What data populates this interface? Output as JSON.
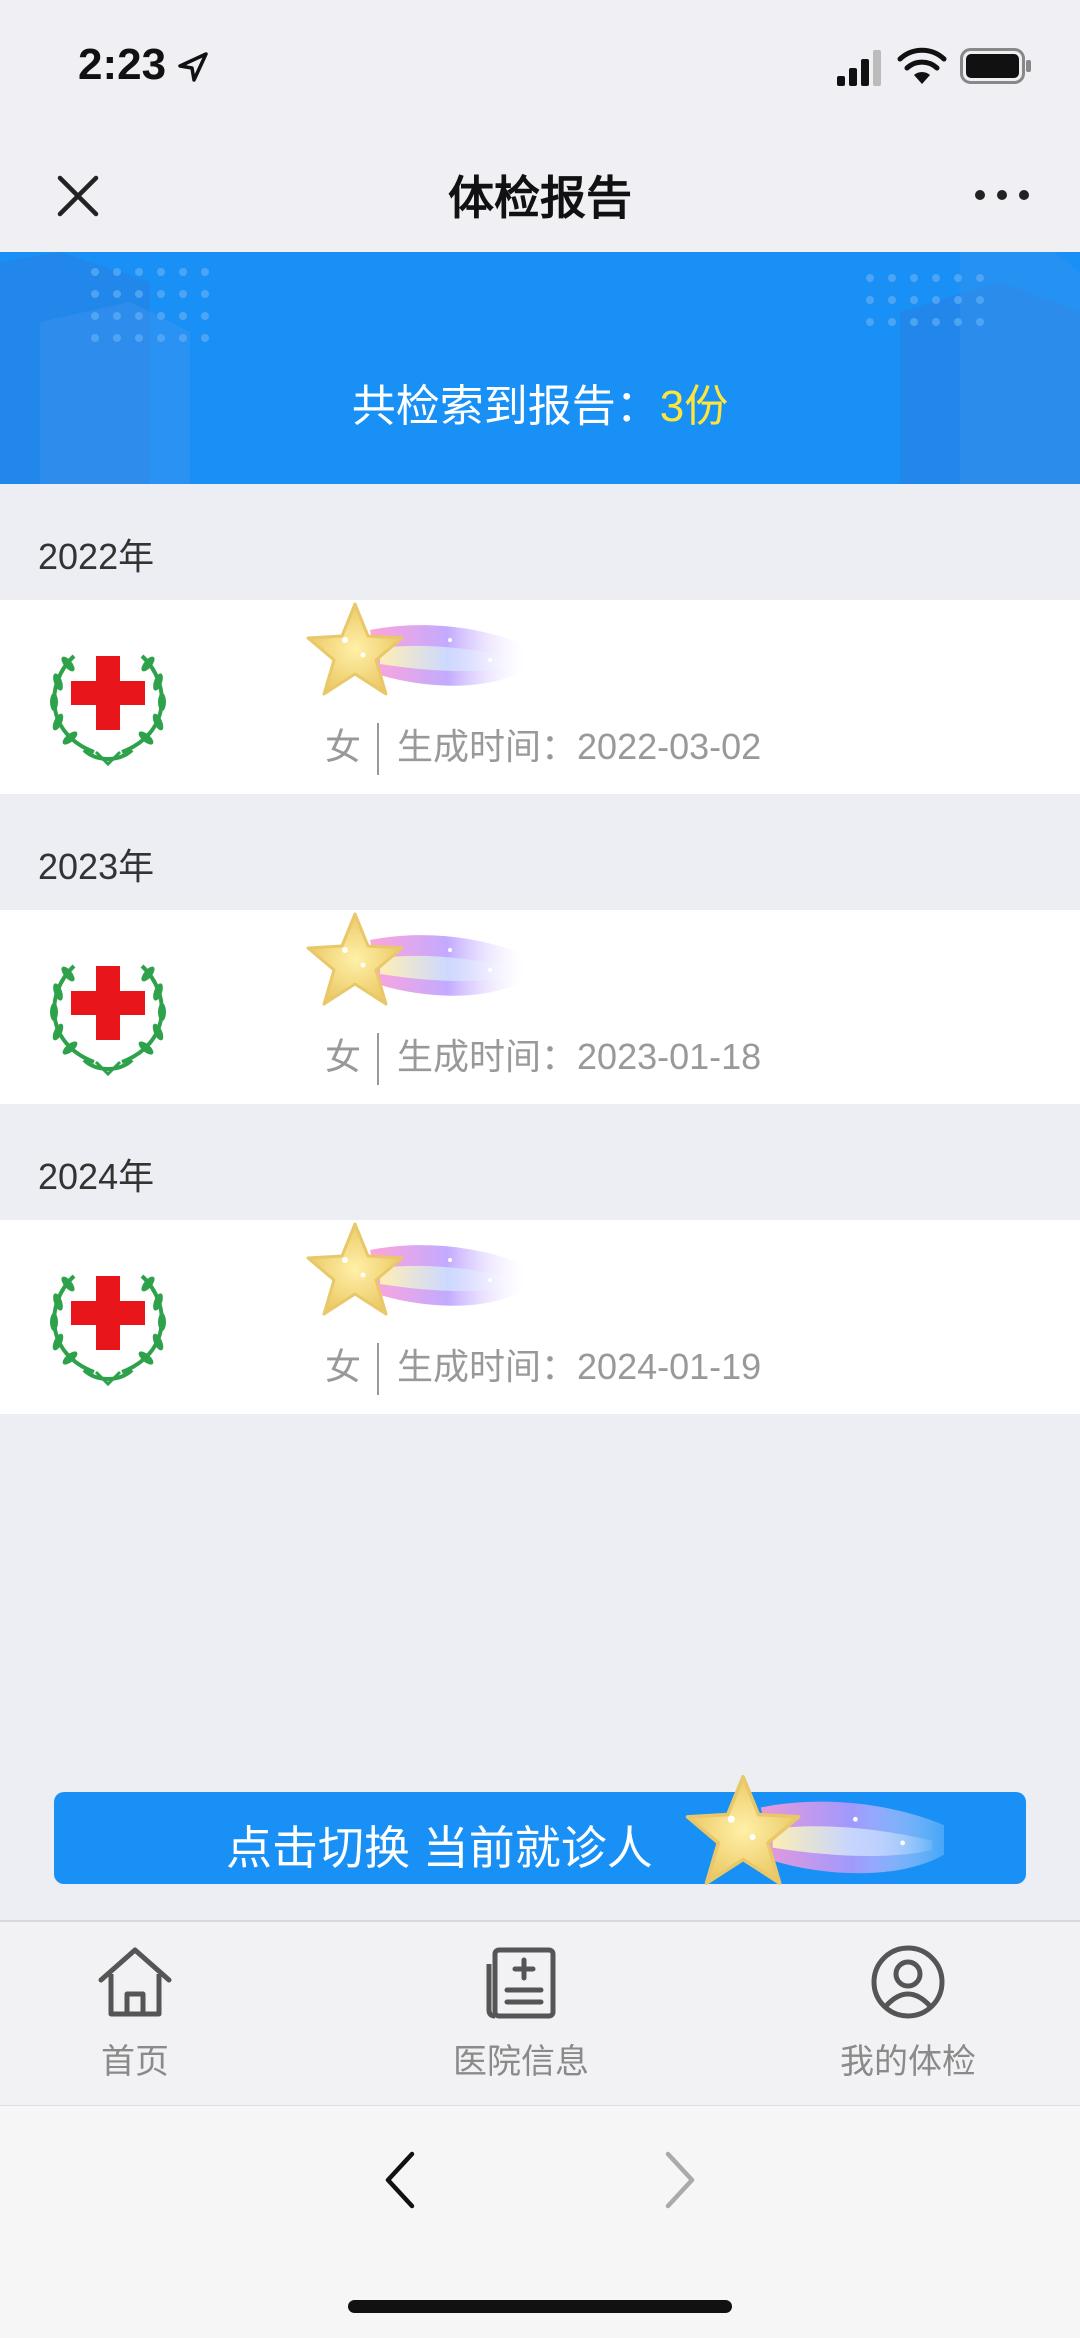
{
  "status_bar": {
    "time": "2:23"
  },
  "nav": {
    "title": "体检报告"
  },
  "banner": {
    "prefix": "共检索到报告：",
    "count": "3份"
  },
  "reports": [
    {
      "year": "2022年",
      "gender": "女",
      "time_label": "生成时间：",
      "date": "2022-03-02"
    },
    {
      "year": "2023年",
      "gender": "女",
      "time_label": "生成时间：",
      "date": "2023-01-18"
    },
    {
      "year": "2024年",
      "gender": "女",
      "time_label": "生成时间：",
      "date": "2024-01-19"
    }
  ],
  "switch_button": {
    "label": "点击切换 当前就诊人"
  },
  "tabbar": [
    {
      "label": "首页",
      "icon": "home-icon"
    },
    {
      "label": "医院信息",
      "icon": "hospital-info-icon"
    },
    {
      "label": "我的体检",
      "icon": "user-icon"
    }
  ],
  "colors": {
    "accent": "#1890f5",
    "count": "#ffe53b",
    "cross": "#e8151b",
    "wreath": "#2ea24a"
  }
}
